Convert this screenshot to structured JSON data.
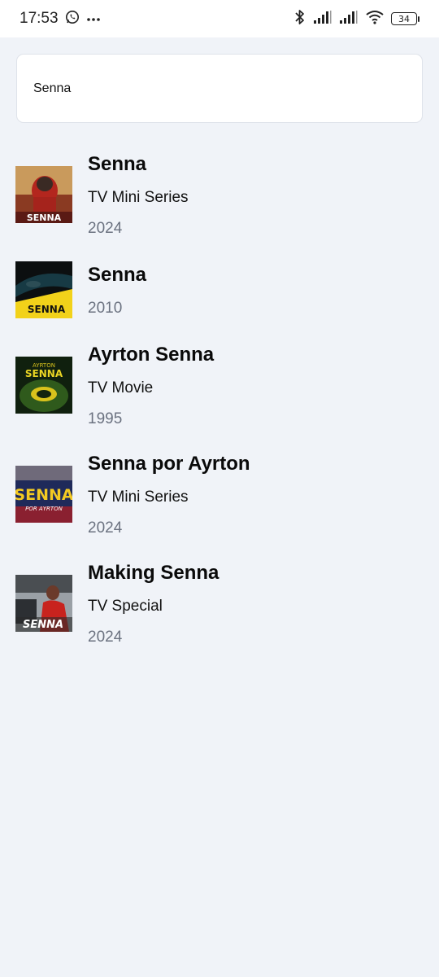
{
  "status_bar": {
    "time": "17:53",
    "icons": [
      "whatsapp-icon",
      "more-dots-icon",
      "bluetooth-icon",
      "signal-icon",
      "signal-icon",
      "wifi-icon"
    ],
    "battery": "34"
  },
  "search": {
    "value": "Senna"
  },
  "results": [
    {
      "title": "Senna",
      "type": "TV Mini Series",
      "year": "2024",
      "poster_text": "SENNA"
    },
    {
      "title": "Senna",
      "type": "",
      "year": "2010",
      "poster_text": "SENNA"
    },
    {
      "title": "Ayrton Senna",
      "type": "TV Movie",
      "year": "1995",
      "poster_text": "SENNA",
      "poster_subtext": "AYRTON"
    },
    {
      "title": "Senna por Ayrton",
      "type": "TV Mini Series",
      "year": "2024",
      "poster_text": "SENNA",
      "poster_subtext": "POR AYRTON"
    },
    {
      "title": "Making Senna",
      "type": "TV Special",
      "year": "2024",
      "poster_text": "SENNA"
    }
  ]
}
